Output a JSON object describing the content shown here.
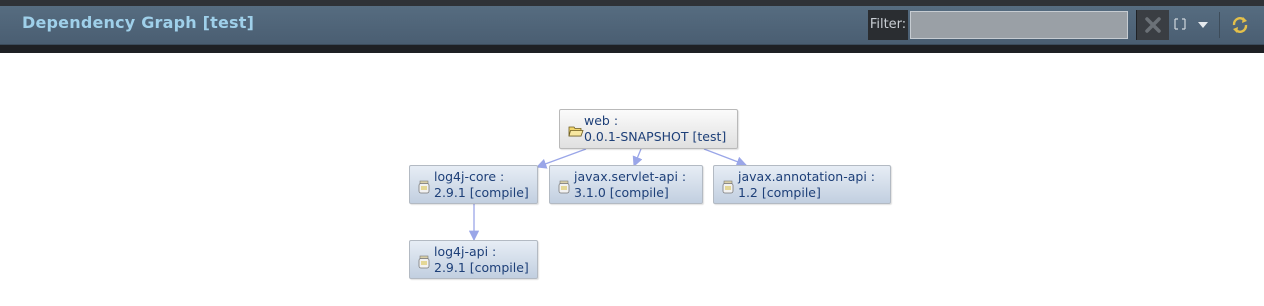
{
  "view": {
    "title": "Dependency Graph [test]",
    "filter_label": "Filter:",
    "filter_value": "",
    "filter_placeholder": "",
    "icons": {
      "clear": "clear-filter-icon",
      "layout": "layout-icon",
      "dropdown": "chevron-down-icon",
      "refresh": "refresh-icon"
    }
  },
  "graph": {
    "nodes": [
      {
        "id": "web",
        "name": "web :",
        "detail": "0.0.1-SNAPSHOT [test]",
        "icon": "folder-icon"
      },
      {
        "id": "log4j-core",
        "name": "log4j-core :",
        "detail": "2.9.1 [compile]",
        "icon": "jar-icon"
      },
      {
        "id": "javax-servlet-api",
        "name": "javax.servlet-api :",
        "detail": "3.1.0 [compile]",
        "icon": "jar-icon"
      },
      {
        "id": "javax-annotation-api",
        "name": "javax.annotation-api :",
        "detail": "1.2 [compile]",
        "icon": "jar-icon"
      },
      {
        "id": "log4j-api",
        "name": "log4j-api :",
        "detail": "2.9.1 [compile]",
        "icon": "jar-icon"
      }
    ],
    "edges": [
      {
        "from": "web",
        "to": "log4j-core"
      },
      {
        "from": "web",
        "to": "javax-servlet-api"
      },
      {
        "from": "web",
        "to": "javax-annotation-api"
      },
      {
        "from": "log4j-core",
        "to": "log4j-api"
      }
    ]
  },
  "colors": {
    "header": "#4f6479",
    "title": "#9fd0ea",
    "node_fill": "#d3dcea",
    "node_text": "#1d3f78",
    "edge": "#9aa6e8"
  }
}
